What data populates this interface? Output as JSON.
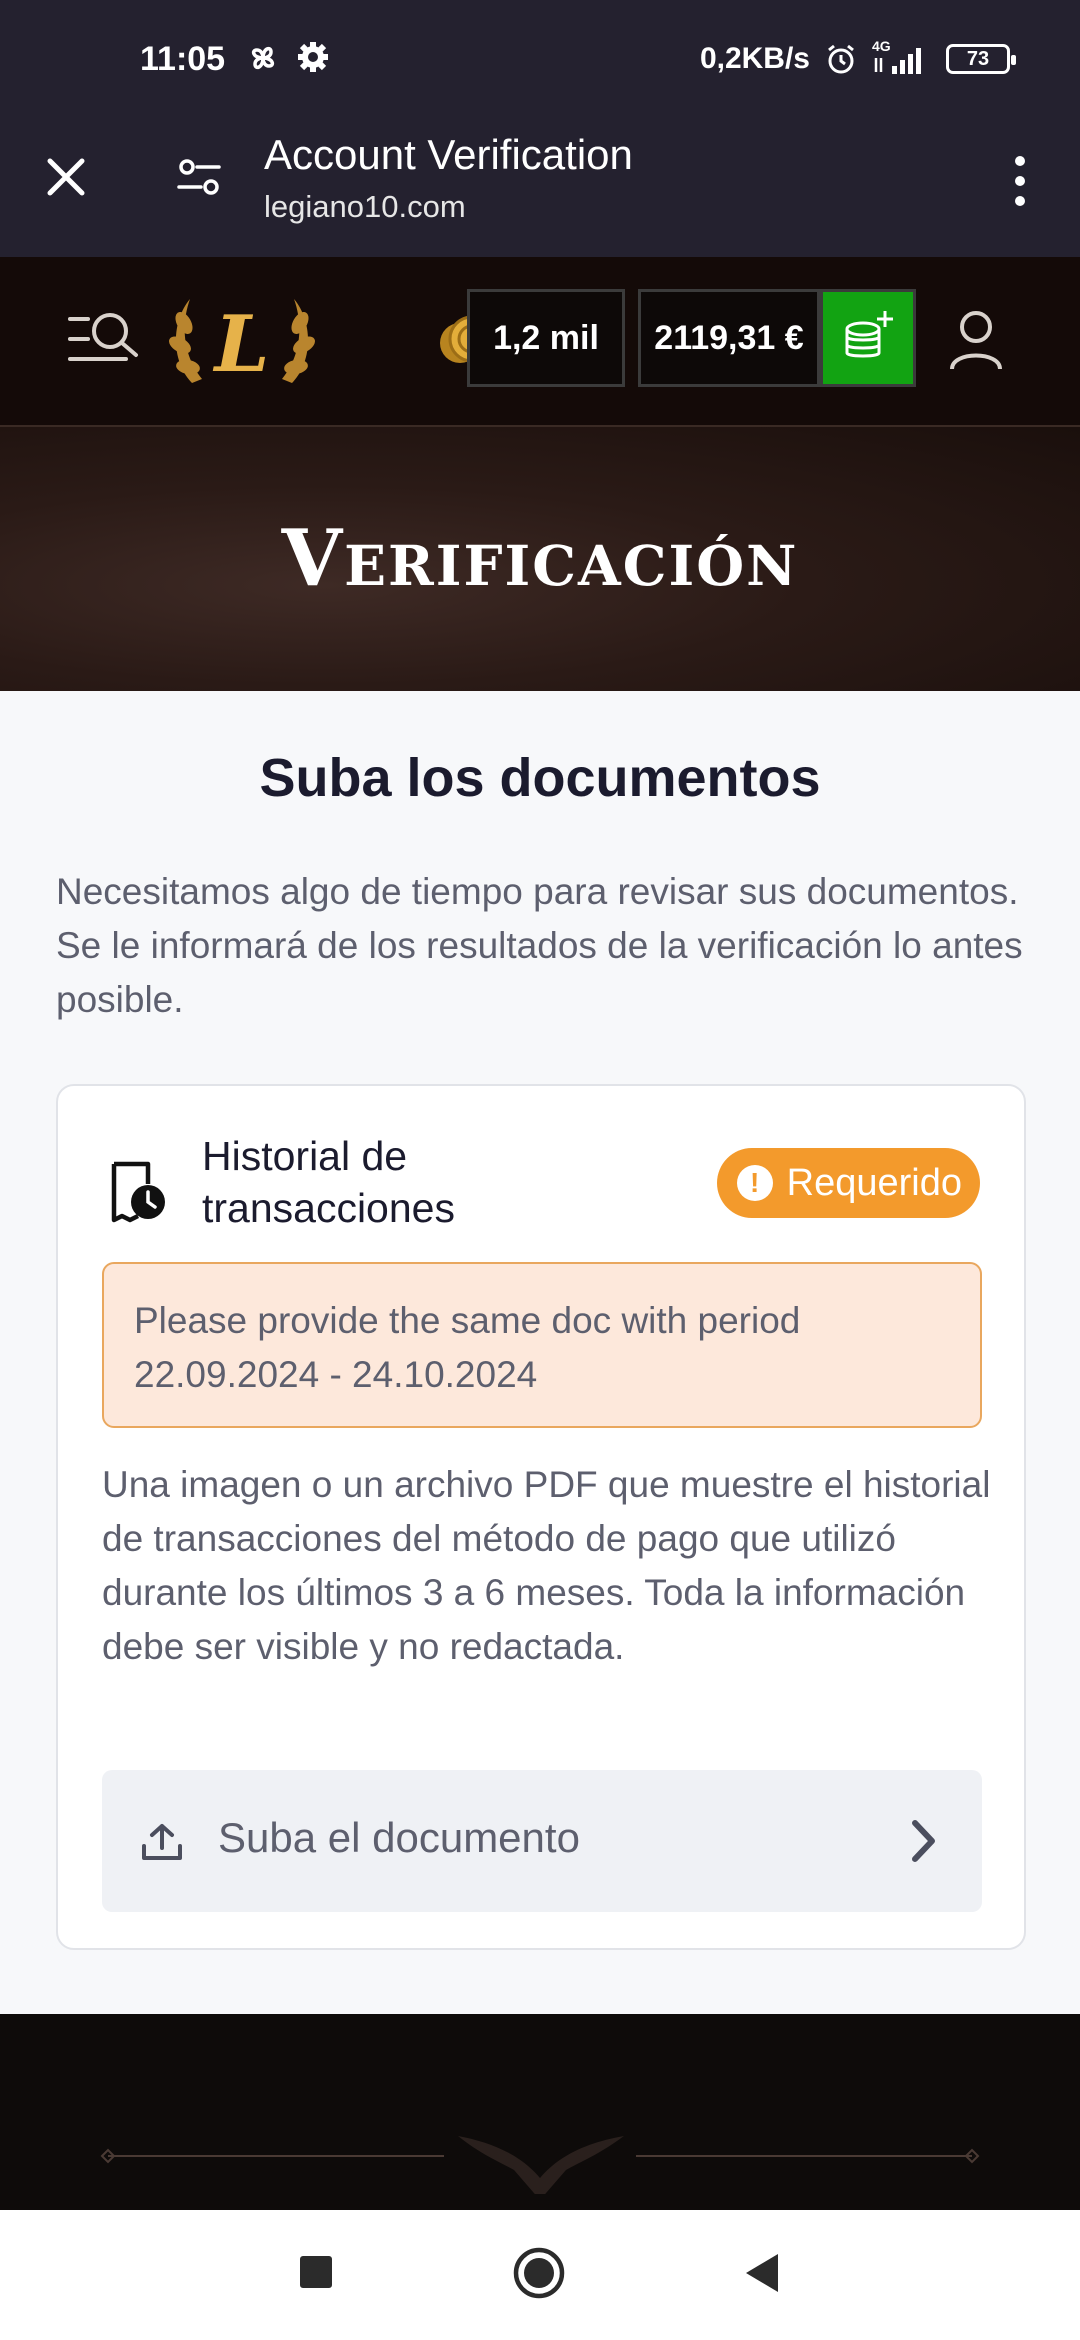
{
  "status_bar": {
    "time": "11:05",
    "network_speed": "0,2KB/s",
    "network_type": "4G",
    "battery": "73",
    "icons": [
      "pinwheel-icon",
      "settings-icon",
      "alarm-icon",
      "signal-icon",
      "battery-icon"
    ]
  },
  "browser": {
    "title": "Account Verification",
    "url": "legiano10.com"
  },
  "header": {
    "points": "1,2 mil",
    "balance": "2119,31 €"
  },
  "hero": {
    "title": "Verificación"
  },
  "main": {
    "heading": "Suba los documentos",
    "intro": "Necesitamos algo de tiempo para revisar sus documentos. Se le informará de los resultados de la verificación lo antes posible.",
    "card": {
      "title": "Historial de transacciones",
      "badge": "Requerido",
      "badge_color": "#f39a2c",
      "alert": "Please provide the same doc with period 22.09.2024 - 24.10.2024",
      "description": "Una imagen o un archivo PDF que muestre el historial de transacciones del método de pago que utilizó durante los últimos 3 a 6 meses. Toda la información debe ser visible y no redactada.",
      "upload_label": "Suba el documento"
    }
  },
  "colors": {
    "deposit_green": "#12a312",
    "gold": "#d4a33b"
  }
}
